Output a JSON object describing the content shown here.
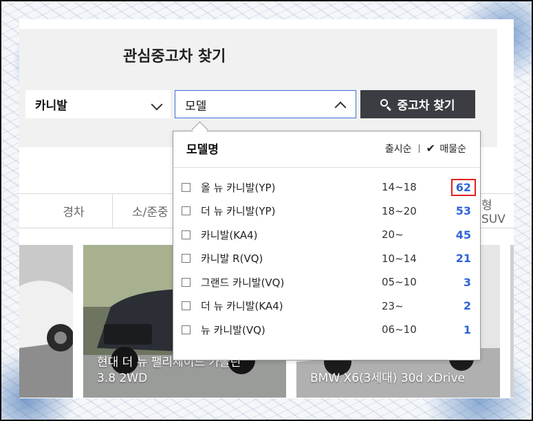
{
  "search": {
    "title": "관심중고차 찾기",
    "maker_value": "카니발",
    "model_value": "모델",
    "button_label": "중고차 찾기"
  },
  "tabs": [
    "경차",
    "소/준중",
    "형SUV"
  ],
  "cards": [
    {
      "title": ""
    },
    {
      "title": "현대 더 뉴 팰리세이드 가솔린\n3.8 2WD"
    },
    {
      "title": "BMW X6(3세대) 30d xDrive"
    }
  ],
  "dropdown": {
    "title": "모델명",
    "sort_release": "출시순",
    "sort_listing": "매물순",
    "items": [
      {
        "name": "올 뉴 카니발(YP)",
        "years": "14~18",
        "count": "62",
        "highlighted": true
      },
      {
        "name": "더 뉴 카니발(YP)",
        "years": "18~20",
        "count": "53"
      },
      {
        "name": "카니발(KA4)",
        "years": "20~",
        "count": "45"
      },
      {
        "name": "카니발 R(VQ)",
        "years": "10~14",
        "count": "21"
      },
      {
        "name": "그랜드 카니발(VQ)",
        "years": "05~10",
        "count": "3"
      },
      {
        "name": "더 뉴 카니발(KA4)",
        "years": "23~",
        "count": "2"
      },
      {
        "name": "뉴 카니발(VQ)",
        "years": "06~10",
        "count": "1"
      }
    ]
  },
  "colors": {
    "accent": "#2f63d6",
    "highlight": "#e0201f",
    "button": "#3b3d42"
  }
}
